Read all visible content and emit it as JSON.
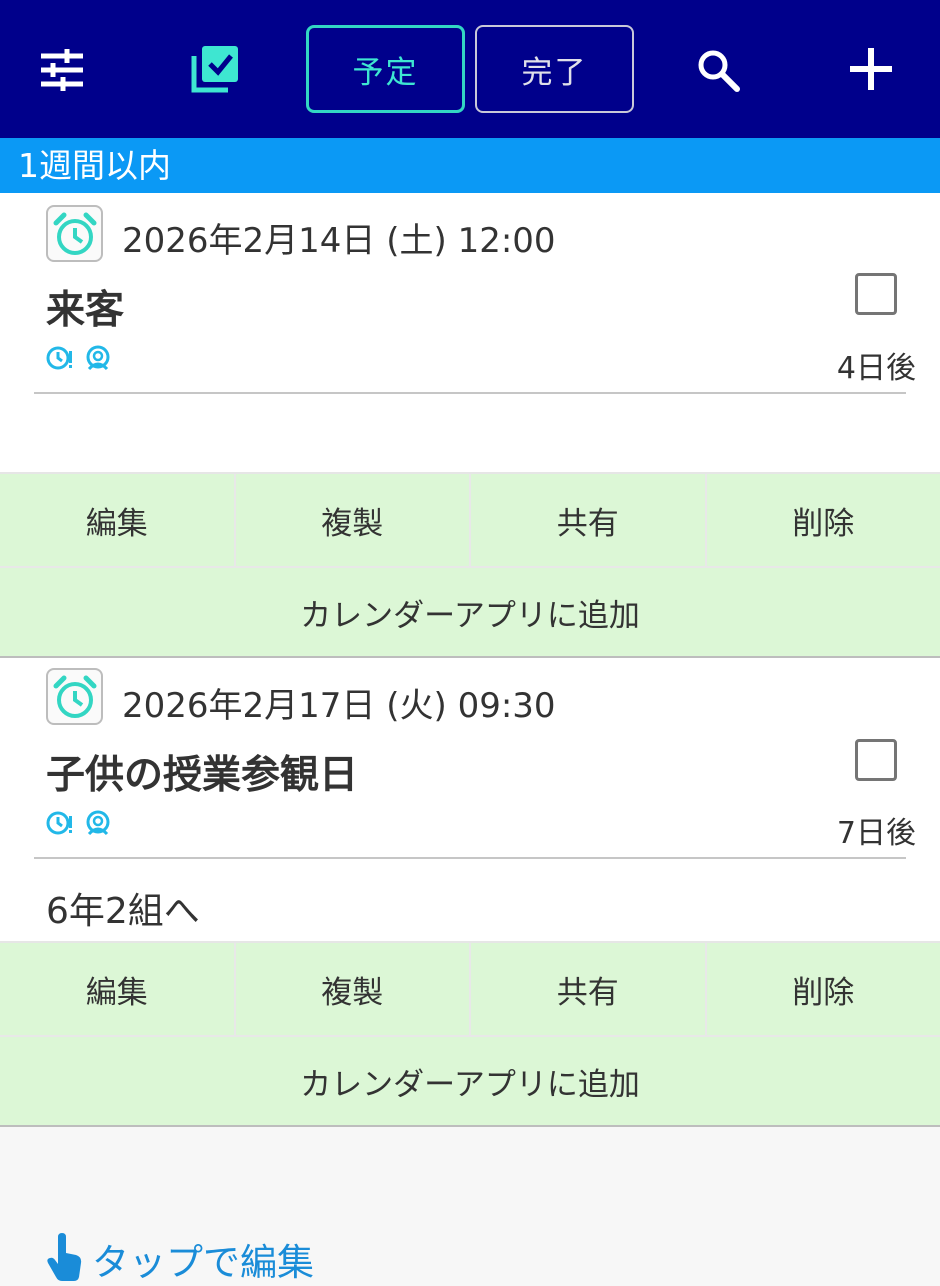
{
  "toolbar": {
    "tab_scheduled": "予定",
    "tab_done": "完了"
  },
  "section": {
    "title": "1週間以内"
  },
  "cards": [
    {
      "datetime": "2026年2月14日 (土)  12:00",
      "title": "来客",
      "days_until": "4日後",
      "memo": ""
    },
    {
      "datetime": "2026年2月17日 (火)  09:30",
      "title": "子供の授業参観日",
      "days_until": "7日後",
      "memo": "6年2組へ"
    }
  ],
  "actions": {
    "edit": "編集",
    "duplicate": "複製",
    "share": "共有",
    "delete": "削除",
    "add_to_calendar": "カレンダーアプリに追加"
  },
  "hint": {
    "text": "タップで編集"
  },
  "colors": {
    "topbar": "#00008b",
    "accent": "#3ee6d1",
    "section": "#0b99f5",
    "action_bg": "#dcf7d6",
    "hint": "#1a8cd8"
  },
  "icons": [
    "sliders-icon",
    "checklist-icon",
    "search-icon",
    "plus-icon",
    "alarm-icon",
    "clock-alert-icon",
    "person-icon",
    "tap-finger-icon"
  ]
}
